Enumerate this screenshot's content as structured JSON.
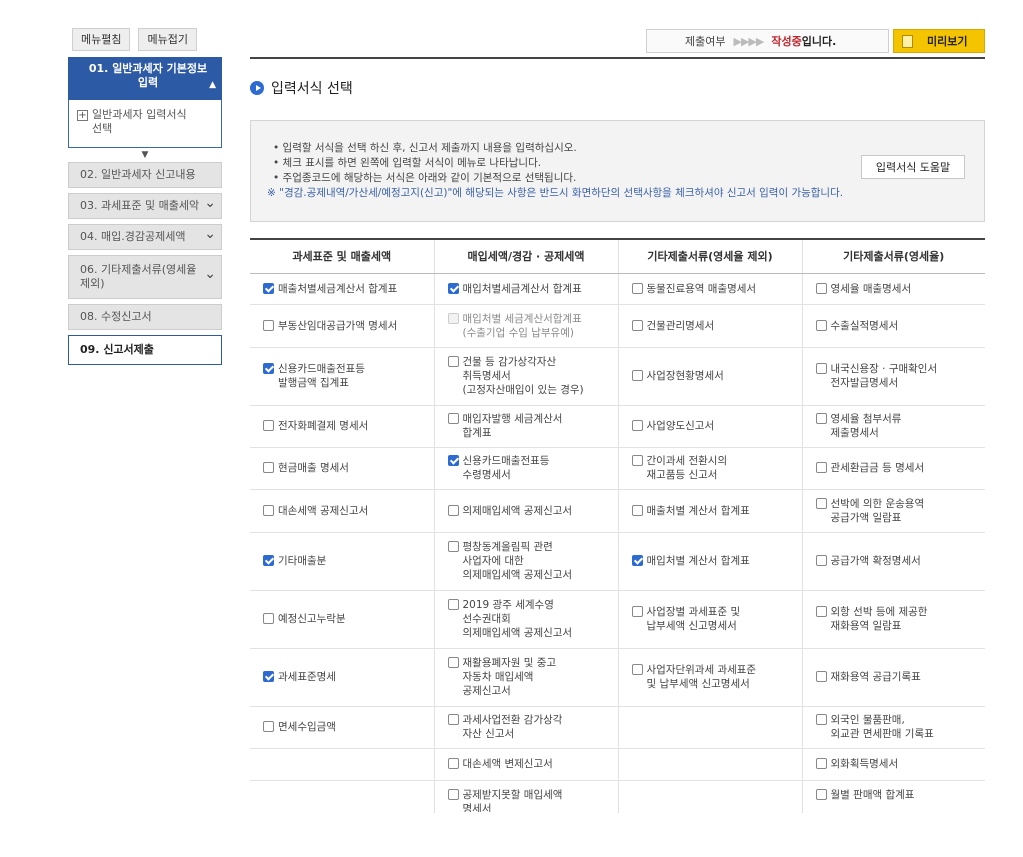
{
  "sidebar": {
    "menu_expand": "메뉴펼침",
    "menu_collapse": "메뉴접기",
    "active_step": "01. 일반과세자 기본정보\n입력",
    "substep": "일반과세자 입력서식\n선택",
    "steps": [
      {
        "label": "02. 일반과세자 신고내용",
        "chevron": false
      },
      {
        "label": "03. 과세표준 및 매출세악",
        "chevron": true
      },
      {
        "label": "04. 매입.경감공제세액",
        "chevron": true
      },
      {
        "label": "06. 기타제출서류(영세율\n제외)",
        "chevron": true
      },
      {
        "label": "08. 수정신고서",
        "chevron": false
      },
      {
        "label": "09. 신고서제출",
        "chevron": false
      }
    ]
  },
  "status": {
    "label": "제출여부",
    "arrows": "▶▶▶▶",
    "state": "작성중",
    "suffix": "입니다."
  },
  "preview_button": "미리보기",
  "section_title": "입력서식 선택",
  "info": {
    "line1": "• 입력할 서식을 선택 하신 후, 신고서 제출까지 내용을 입력하십시오.",
    "line2": "• 체크 표시를 하면 왼쪽에 입력할 서식이 메뉴로 나타납니다.",
    "line3": "• 주업종코드에 해당하는 서식은 아래와 같이 기본적으로 선택됩니다.",
    "note": "※ \"경감.공제내역/가산세/예정고지(신고)\"에 해당되는 사항은 반드시 화면하단의 선택사항을 체크하셔야 신고서 입력이 가능합니다.",
    "help_button": "입력서식 도움말"
  },
  "table": {
    "headers": [
      "과세표준 및 매출세액",
      "매입세액/경감 · 공제세액",
      "기타제출서류(영세율 제외)",
      "기타제출서류(영세율)"
    ],
    "rows": [
      [
        {
          "label": "매출처별세금계산서 합계표",
          "checked": true
        },
        {
          "label": "매입처별세금계산서 합계표",
          "checked": true
        },
        {
          "label": "동물진료용역 매출명세서",
          "checked": false
        },
        {
          "label": "영세율 매출명세서",
          "checked": false
        }
      ],
      [
        {
          "label": "부동산임대공급가액 명세서",
          "checked": false
        },
        {
          "label": "매입처별 세금계산서합계표\n(수출기업 수입 납부유예)",
          "checked": false,
          "disabled": true
        },
        {
          "label": "건물관리명세서",
          "checked": false
        },
        {
          "label": "수출실적명세서",
          "checked": false
        }
      ],
      [
        {
          "label": "신용카드매출전표등\n발행금액 집계표",
          "checked": true
        },
        {
          "label": "건물 등 감가상각자산\n취득명세서\n(고정자산매입이 있는 경우)",
          "checked": false
        },
        {
          "label": "사업장현황명세서",
          "checked": false
        },
        {
          "label": "내국신용장 · 구매확인서\n전자발급명세서",
          "checked": false
        }
      ],
      [
        {
          "label": "전자화폐결제 명세서",
          "checked": false
        },
        {
          "label": "매입자발행 세금계산서\n합계표",
          "checked": false
        },
        {
          "label": "사업양도신고서",
          "checked": false
        },
        {
          "label": "영세율 첨부서류\n제출명세서",
          "checked": false
        }
      ],
      [
        {
          "label": "현금매출 명세서",
          "checked": false
        },
        {
          "label": "신용카드매출전표등\n수령명세서",
          "checked": true
        },
        {
          "label": "간이과세 전환시의\n재고품등 신고서",
          "checked": false
        },
        {
          "label": "관세환급금 등 명세서",
          "checked": false
        }
      ],
      [
        {
          "label": "대손세액 공제신고서",
          "checked": false
        },
        {
          "label": "의제매입세액 공제신고서",
          "checked": false
        },
        {
          "label": "매출처별 계산서 합계표",
          "checked": false
        },
        {
          "label": "선박에 의한 운송용역\n공급가액 일람표",
          "checked": false
        }
      ],
      [
        {
          "label": "기타매출분",
          "checked": true
        },
        {
          "label": "평창동계올림픽 관련\n사업자에 대한\n의제매입세액 공제신고서",
          "checked": false
        },
        {
          "label": "매입처별 계산서 합계표",
          "checked": true
        },
        {
          "label": "공급가액 확정명세서",
          "checked": false
        }
      ],
      [
        {
          "label": "예정신고누락분",
          "checked": false
        },
        {
          "label": "2019 광주 세계수영\n선수권대회\n의제매입세액 공제신고서",
          "checked": false
        },
        {
          "label": "사업장별 과세표준 및\n납부세액 신고명세서",
          "checked": false
        },
        {
          "label": "외항 선박 등에 제공한\n재화용역 일람표",
          "checked": false
        }
      ],
      [
        {
          "label": "과세표준명세",
          "checked": true
        },
        {
          "label": "재활용폐자원 및 중고\n자동차 매입세액\n공제신고서",
          "checked": false
        },
        {
          "label": "사업자단위과세 과세표준\n및 납부세액 신고명세서",
          "checked": false
        },
        {
          "label": "재화용역 공급기록표",
          "checked": false
        }
      ],
      [
        {
          "label": "면세수입금액",
          "checked": false
        },
        {
          "label": "과세사업전환 감가상각\n자산 신고서",
          "checked": false
        },
        null,
        {
          "label": "외국인 물품판매,\n외교관 면세판매 기록표",
          "checked": false
        }
      ],
      [
        null,
        {
          "label": "대손세액 변제신고서",
          "checked": false
        },
        null,
        {
          "label": "외화획득명세서",
          "checked": false
        }
      ],
      [
        null,
        {
          "label": "공제받지못할 매입세액\n명세서",
          "checked": false
        },
        null,
        {
          "label": "월별 판매액 합계표",
          "checked": false
        }
      ]
    ]
  }
}
